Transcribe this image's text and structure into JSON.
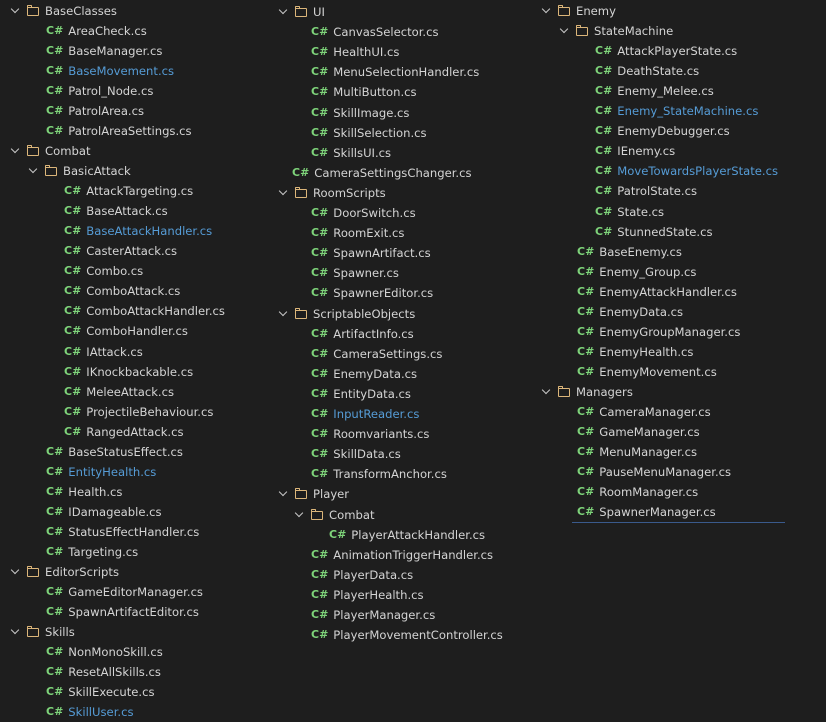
{
  "cs_badge": "C#",
  "columns": [
    {
      "rows": [
        {
          "type": "folder",
          "level": 0,
          "label": "BaseClasses"
        },
        {
          "type": "file",
          "level": 1,
          "label": "AreaCheck.cs"
        },
        {
          "type": "file",
          "level": 1,
          "label": "BaseManager.cs"
        },
        {
          "type": "file",
          "level": 1,
          "label": "BaseMovement.cs",
          "highlight": true
        },
        {
          "type": "file",
          "level": 1,
          "label": "Patrol_Node.cs"
        },
        {
          "type": "file",
          "level": 1,
          "label": "PatrolArea.cs"
        },
        {
          "type": "file",
          "level": 1,
          "label": "PatrolAreaSettings.cs"
        },
        {
          "type": "folder",
          "level": 0,
          "label": "Combat"
        },
        {
          "type": "folder",
          "level": 1,
          "label": "BasicAttack"
        },
        {
          "type": "file",
          "level": 2,
          "label": "AttackTargeting.cs"
        },
        {
          "type": "file",
          "level": 2,
          "label": "BaseAttack.cs"
        },
        {
          "type": "file",
          "level": 2,
          "label": "BaseAttackHandler.cs",
          "highlight": true
        },
        {
          "type": "file",
          "level": 2,
          "label": "CasterAttack.cs"
        },
        {
          "type": "file",
          "level": 2,
          "label": "Combo.cs"
        },
        {
          "type": "file",
          "level": 2,
          "label": "ComboAttack.cs"
        },
        {
          "type": "file",
          "level": 2,
          "label": "ComboAttackHandler.cs"
        },
        {
          "type": "file",
          "level": 2,
          "label": "ComboHandler.cs"
        },
        {
          "type": "file",
          "level": 2,
          "label": "IAttack.cs"
        },
        {
          "type": "file",
          "level": 2,
          "label": "IKnockbackable.cs"
        },
        {
          "type": "file",
          "level": 2,
          "label": "MeleeAttack.cs"
        },
        {
          "type": "file",
          "level": 2,
          "label": "ProjectileBehaviour.cs"
        },
        {
          "type": "file",
          "level": 2,
          "label": "RangedAttack.cs"
        },
        {
          "type": "file",
          "level": 1,
          "label": "BaseStatusEffect.cs"
        },
        {
          "type": "file",
          "level": 1,
          "label": "EntityHealth.cs",
          "highlight": true
        },
        {
          "type": "file",
          "level": 1,
          "label": "Health.cs"
        },
        {
          "type": "file",
          "level": 1,
          "label": "IDamageable.cs"
        },
        {
          "type": "file",
          "level": 1,
          "label": "StatusEffectHandler.cs"
        },
        {
          "type": "file",
          "level": 1,
          "label": "Targeting.cs"
        },
        {
          "type": "folder",
          "level": 0,
          "label": "EditorScripts"
        },
        {
          "type": "file",
          "level": 1,
          "label": "GameEditorManager.cs"
        },
        {
          "type": "file",
          "level": 1,
          "label": "SpawnArtifactEditor.cs"
        },
        {
          "type": "folder",
          "level": 0,
          "label": "Skills"
        },
        {
          "type": "file",
          "level": 1,
          "label": "NonMonoSkill.cs"
        },
        {
          "type": "file",
          "level": 1,
          "label": "ResetAllSkills.cs"
        },
        {
          "type": "file",
          "level": 1,
          "label": "SkillExecute.cs"
        },
        {
          "type": "file",
          "level": 1,
          "label": "SkillUser.cs",
          "highlight": true
        }
      ]
    },
    {
      "rows": [
        {
          "type": "folder",
          "level": 0,
          "label": "UI"
        },
        {
          "type": "file",
          "level": 1,
          "label": "CanvasSelector.cs"
        },
        {
          "type": "file",
          "level": 1,
          "label": "HealthUI.cs"
        },
        {
          "type": "file",
          "level": 1,
          "label": "MenuSelectionHandler.cs"
        },
        {
          "type": "file",
          "level": 1,
          "label": "MultiButton.cs"
        },
        {
          "type": "file",
          "level": 1,
          "label": "SkillImage.cs"
        },
        {
          "type": "file",
          "level": 1,
          "label": "SkillSelection.cs"
        },
        {
          "type": "file",
          "level": 1,
          "label": "SkillsUI.cs"
        },
        {
          "type": "file",
          "level": 0,
          "label": "CameraSettingsChanger.cs"
        },
        {
          "type": "folder",
          "level": 0,
          "label": "RoomScripts"
        },
        {
          "type": "file",
          "level": 1,
          "label": "DoorSwitch.cs"
        },
        {
          "type": "file",
          "level": 1,
          "label": "RoomExit.cs"
        },
        {
          "type": "file",
          "level": 1,
          "label": "SpawnArtifact.cs"
        },
        {
          "type": "file",
          "level": 1,
          "label": "Spawner.cs"
        },
        {
          "type": "file",
          "level": 1,
          "label": "SpawnerEditor.cs"
        },
        {
          "type": "folder",
          "level": 0,
          "label": "ScriptableObjects"
        },
        {
          "type": "file",
          "level": 1,
          "label": "ArtifactInfo.cs"
        },
        {
          "type": "file",
          "level": 1,
          "label": "CameraSettings.cs"
        },
        {
          "type": "file",
          "level": 1,
          "label": "EnemyData.cs"
        },
        {
          "type": "file",
          "level": 1,
          "label": "EntityData.cs"
        },
        {
          "type": "file",
          "level": 1,
          "label": "InputReader.cs",
          "highlight": true
        },
        {
          "type": "file",
          "level": 1,
          "label": "Roomvariants.cs"
        },
        {
          "type": "file",
          "level": 1,
          "label": "SkillData.cs"
        },
        {
          "type": "file",
          "level": 1,
          "label": "TransformAnchor.cs"
        },
        {
          "type": "folder",
          "level": 0,
          "label": "Player"
        },
        {
          "type": "folder",
          "level": 1,
          "label": "Combat"
        },
        {
          "type": "file",
          "level": 2,
          "label": "PlayerAttackHandler.cs"
        },
        {
          "type": "file",
          "level": 1,
          "label": "AnimationTriggerHandler.cs"
        },
        {
          "type": "file",
          "level": 1,
          "label": "PlayerData.cs"
        },
        {
          "type": "file",
          "level": 1,
          "label": "PlayerHealth.cs"
        },
        {
          "type": "file",
          "level": 1,
          "label": "PlayerManager.cs"
        },
        {
          "type": "file",
          "level": 1,
          "label": "PlayerMovementController.cs"
        }
      ]
    },
    {
      "rows": [
        {
          "type": "folder",
          "level": 0,
          "label": "Enemy"
        },
        {
          "type": "folder",
          "level": 1,
          "label": "StateMachine"
        },
        {
          "type": "file",
          "level": 2,
          "label": "AttackPlayerState.cs"
        },
        {
          "type": "file",
          "level": 2,
          "label": "DeathState.cs"
        },
        {
          "type": "file",
          "level": 2,
          "label": "Enemy_Melee.cs"
        },
        {
          "type": "file",
          "level": 2,
          "label": "Enemy_StateMachine.cs",
          "highlight": true
        },
        {
          "type": "file",
          "level": 2,
          "label": "EnemyDebugger.cs"
        },
        {
          "type": "file",
          "level": 2,
          "label": "IEnemy.cs"
        },
        {
          "type": "file",
          "level": 2,
          "label": "MoveTowardsPlayerState.cs",
          "highlight": true
        },
        {
          "type": "file",
          "level": 2,
          "label": "PatrolState.cs"
        },
        {
          "type": "file",
          "level": 2,
          "label": "State.cs"
        },
        {
          "type": "file",
          "level": 2,
          "label": "StunnedState.cs"
        },
        {
          "type": "file",
          "level": 1,
          "label": "BaseEnemy.cs"
        },
        {
          "type": "file",
          "level": 1,
          "label": "Enemy_Group.cs"
        },
        {
          "type": "file",
          "level": 1,
          "label": "EnemyAttackHandler.cs"
        },
        {
          "type": "file",
          "level": 1,
          "label": "EnemyData.cs"
        },
        {
          "type": "file",
          "level": 1,
          "label": "EnemyGroupManager.cs"
        },
        {
          "type": "file",
          "level": 1,
          "label": "EnemyHealth.cs"
        },
        {
          "type": "file",
          "level": 1,
          "label": "EnemyMovement.cs"
        },
        {
          "type": "folder",
          "level": 0,
          "label": "Managers"
        },
        {
          "type": "file",
          "level": 1,
          "label": "CameraManager.cs"
        },
        {
          "type": "file",
          "level": 1,
          "label": "GameManager.cs"
        },
        {
          "type": "file",
          "level": 1,
          "label": "MenuManager.cs"
        },
        {
          "type": "file",
          "level": 1,
          "label": "PauseMenuManager.cs"
        },
        {
          "type": "file",
          "level": 1,
          "label": "RoomManager.cs"
        },
        {
          "type": "file",
          "level": 1,
          "label": "SpawnerManager.cs",
          "selected": true
        }
      ]
    }
  ]
}
